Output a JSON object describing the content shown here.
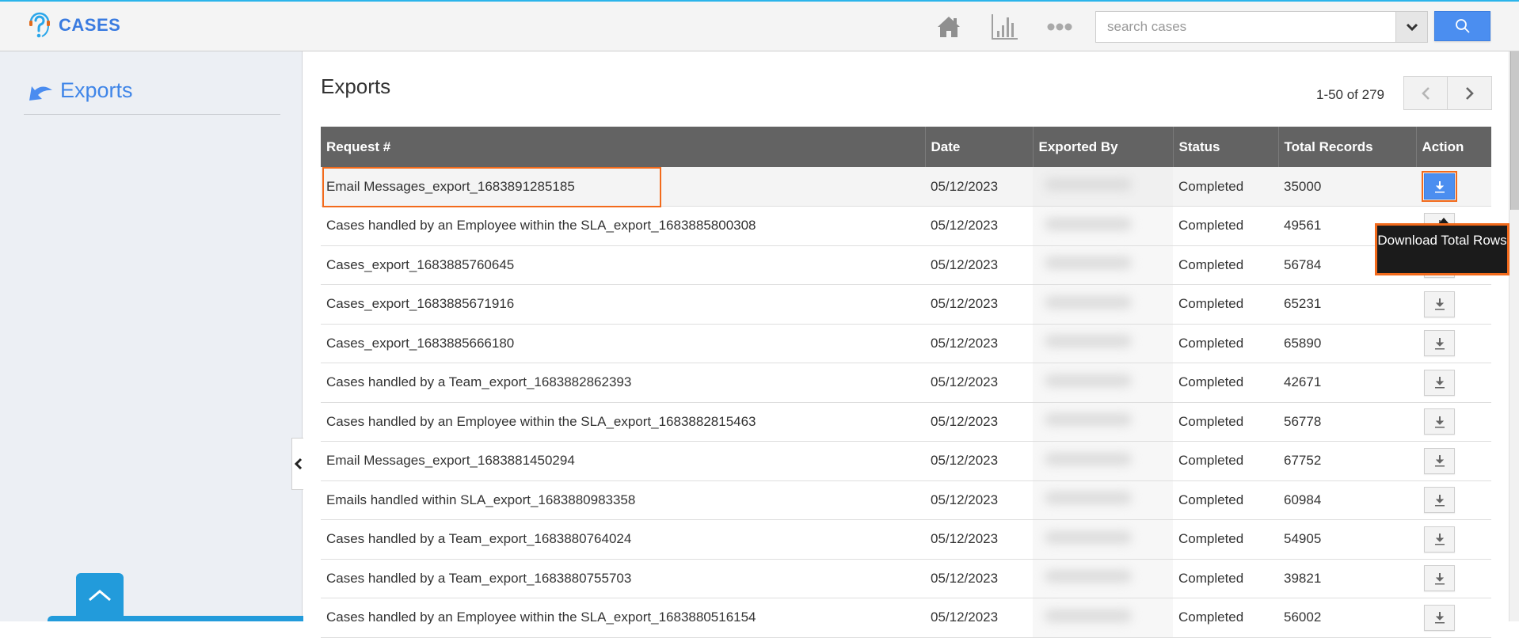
{
  "app": {
    "title": "CASES",
    "brand_color": "#3a7be0",
    "accent_color": "#2ab4ea",
    "highlight_color": "#f26a1b"
  },
  "topbar": {
    "icons": [
      "home-icon",
      "chart-icon",
      "more-icon"
    ],
    "search": {
      "placeholder": "search cases",
      "value": ""
    }
  },
  "sidebar": {
    "items": [
      {
        "label": "Exports",
        "icon": "back-arrow-icon"
      }
    ]
  },
  "main": {
    "title": "Exports",
    "pagination": {
      "text": "1-50 of 279",
      "range_start": 1,
      "range_end": 50,
      "total": 279
    },
    "table": {
      "columns": [
        "Request #",
        "Date",
        "Exported By",
        "Status",
        "Total Records",
        "Action"
      ],
      "rows": [
        {
          "request": "Email Messages_export_1683891285185",
          "date": "05/12/2023",
          "exported_by": "",
          "status": "Completed",
          "total": "35000"
        },
        {
          "request": "Cases handled by an Employee within the SLA_export_1683885800308",
          "date": "05/12/2023",
          "exported_by": "",
          "status": "Completed",
          "total": "49561"
        },
        {
          "request": "Cases_export_1683885760645",
          "date": "05/12/2023",
          "exported_by": "",
          "status": "Completed",
          "total": "56784"
        },
        {
          "request": "Cases_export_1683885671916",
          "date": "05/12/2023",
          "exported_by": "",
          "status": "Completed",
          "total": "65231"
        },
        {
          "request": "Cases_export_1683885666180",
          "date": "05/12/2023",
          "exported_by": "",
          "status": "Completed",
          "total": "65890"
        },
        {
          "request": "Cases handled by a Team_export_1683882862393",
          "date": "05/12/2023",
          "exported_by": "",
          "status": "Completed",
          "total": "42671"
        },
        {
          "request": "Cases handled by an Employee within the SLA_export_1683882815463",
          "date": "05/12/2023",
          "exported_by": "",
          "status": "Completed",
          "total": "56778"
        },
        {
          "request": "Email Messages_export_1683881450294",
          "date": "05/12/2023",
          "exported_by": "",
          "status": "Completed",
          "total": "67752"
        },
        {
          "request": "Emails handled within SLA_export_1683880983358",
          "date": "05/12/2023",
          "exported_by": "",
          "status": "Completed",
          "total": "60984"
        },
        {
          "request": "Cases handled by a Team_export_1683880764024",
          "date": "05/12/2023",
          "exported_by": "",
          "status": "Completed",
          "total": "54905"
        },
        {
          "request": "Cases handled by a Team_export_1683880755703",
          "date": "05/12/2023",
          "exported_by": "",
          "status": "Completed",
          "total": "39821"
        },
        {
          "request": "Cases handled by an Employee within the SLA_export_1683880516154",
          "date": "05/12/2023",
          "exported_by": "",
          "status": "Completed",
          "total": "56002"
        }
      ]
    },
    "tooltip": "Download Total Rows"
  }
}
